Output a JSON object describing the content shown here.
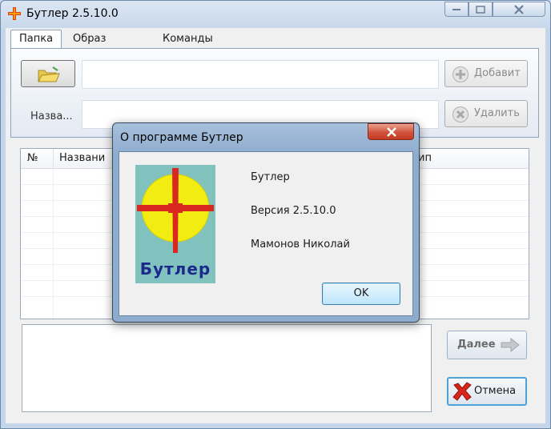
{
  "window": {
    "title": "Бутлер 2.5.10.0"
  },
  "tabs": [
    {
      "label": "Папка",
      "active": true
    },
    {
      "label": "Образ диска",
      "active": false
    },
    {
      "label": "Команды",
      "active": false
    }
  ],
  "folder_panel": {
    "path_value": "",
    "name_label": "Назва...",
    "name_value": "",
    "add_label": "Добавит",
    "delete_label": "Удалить"
  },
  "table": {
    "columns": [
      "№",
      "Названи",
      "ип"
    ],
    "rows": []
  },
  "buttons": {
    "next_label": "Далее",
    "cancel_label": "Отмена"
  },
  "about_dialog": {
    "title": "О программе Бутлер",
    "logo_text": "Бутлер",
    "product": "Бутлер",
    "version": "Версия 2.5.10.0",
    "author": "Мамонов Николай",
    "ok_label": "OK"
  },
  "colors": {
    "logo_background": "#81c2bf",
    "logo_circle": "#f2ec12",
    "logo_cross": "#d8281f",
    "logo_text": "#1b2a8c"
  }
}
